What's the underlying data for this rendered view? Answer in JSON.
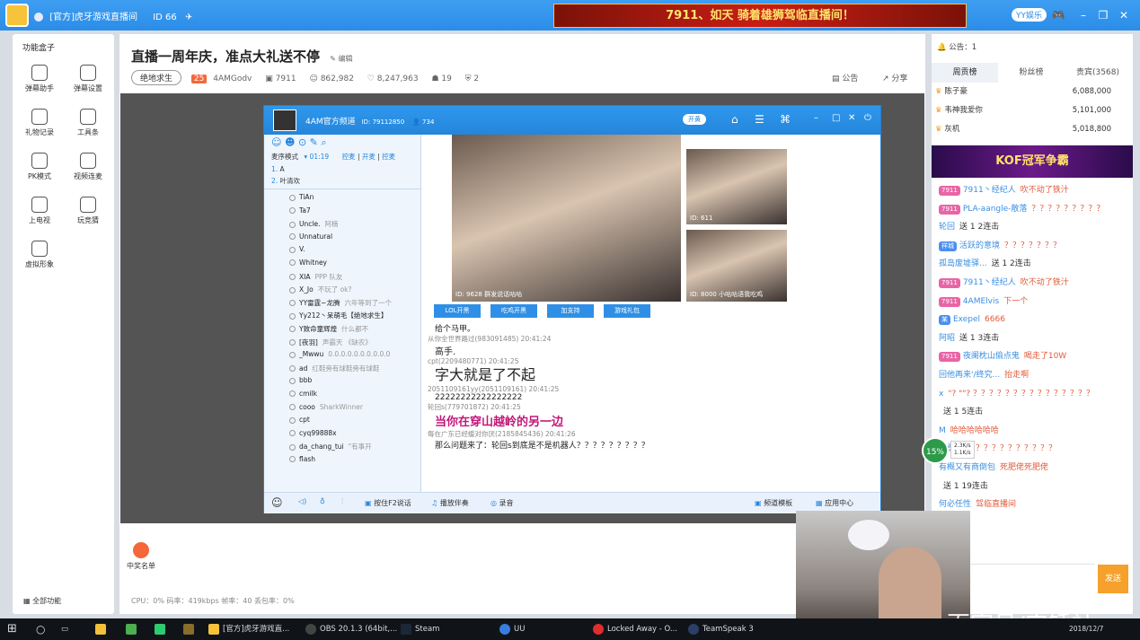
{
  "window": {
    "title": "[官方]虎牙游戏直播间",
    "id_label": "ID 66",
    "banner": "7911、如天  骑着雄狮驾临直播间！",
    "yy_badge": "YY娱乐"
  },
  "left_panel": {
    "heading": "功能盒子",
    "tools": [
      {
        "label": "弹幕助手",
        "icon": "danmaku-helper-icon"
      },
      {
        "label": "弹幕设置",
        "icon": "danmaku-settings-icon"
      },
      {
        "label": "礼物记录",
        "icon": "gift-record-icon"
      },
      {
        "label": "工具条",
        "icon": "toolbar-icon"
      },
      {
        "label": "PK模式",
        "icon": "pk-mode-icon"
      },
      {
        "label": "视频连麦",
        "icon": "video-link-icon"
      },
      {
        "label": "上电视",
        "icon": "tv-icon"
      },
      {
        "label": "玩竞猜",
        "icon": "guess-icon"
      },
      {
        "label": "虚拟形象",
        "icon": "avatar-icon"
      }
    ],
    "winners": "中奖名单",
    "all_functions": "全部功能"
  },
  "room": {
    "title": "直播一周年庆，准点大礼送不停",
    "edit_label": "编辑",
    "category": "绝地求生",
    "level": "25",
    "host": "4AMGodv",
    "room_id": "7911",
    "fans": "862,982",
    "subscribers": "8,247,963",
    "gifts": "19",
    "guards": "2",
    "notice_label": "公告",
    "share_label": "分享"
  },
  "status_bar": "CPU：0%   码率：419kbps   帧率：40   丢包率：0%",
  "yy_window": {
    "title": "4AM官方频道",
    "channel_id": "ID: 79112850",
    "online": "734",
    "toggle": "开黄",
    "mode": "麦序模式",
    "timer": "01:19",
    "actions": [
      "控麦",
      "开麦",
      "控麦"
    ],
    "queue": [
      {
        "pos": "1.",
        "name": "A"
      },
      {
        "pos": "2.",
        "name": "叶清欢"
      }
    ],
    "members": [
      "TiAn",
      "Ta7",
      "Uncle.",
      "Unnatural",
      "V.",
      "Whitney",
      "XIA",
      "X_Jo",
      "YY雷霆~龙腾",
      "Yy212丶呆萌毛【绝地求生】",
      "Y致命童辉煌",
      "[夜羽]",
      "_Mwwu",
      "ad",
      "bbb",
      "cmilk",
      "cooo",
      "cpt",
      "cyq99888x",
      "da_chang_tui",
      "flash"
    ],
    "member_notes": [
      "",
      "",
      "阿楠",
      "",
      "",
      "",
      "PPP 队友",
      "不玩了 ok?",
      "六年等到了一个",
      "",
      "什么都不",
      "声霸天  《缺农》",
      "0.0.0.0.0.0.0.0.0.0",
      "红鞋旁有球鞋旁有球鞋",
      "",
      "",
      "SharkWinner",
      "",
      "",
      "\"有事开",
      ""
    ],
    "video_labels": {
      "main": "ID: 9628   群发说话咕咕",
      "top_right": "ID: 611",
      "bottom_right": "ID: 8000   小咕咕语我吃鸡"
    },
    "video_buttons": [
      "LOL开黑",
      "吃鸡开黑",
      "加支持",
      "游戏礼包"
    ],
    "chat": [
      {
        "meta": "",
        "msg": "给个马甲。"
      },
      {
        "meta": "从你全世界路过(983091485) 20:41:24",
        "msg": "高手."
      },
      {
        "meta": "cpt(2209480771) 20:41:25",
        "msg": "字大就是了不起"
      },
      {
        "meta": "2051109161yy(2051109161) 20:41:25",
        "msg": "22222222222222222"
      },
      {
        "meta": "轮回s(779701872) 20:41:25",
        "msg": "当你在穿山越岭的另一边"
      },
      {
        "meta": "每在广东已经缓对你厌(2185845436) 20:41:26",
        "msg": "那么问题来了：轮回s到底是不是机器人？？？？？？？？？"
      }
    ],
    "bottom": {
      "ptt": "按住F2说话",
      "music": "播放伴奏",
      "record": "录音",
      "template": "频道模板",
      "apps": "应用中心"
    }
  },
  "right_panel": {
    "notice": "公告：1",
    "tabs": [
      "周贡榜",
      "粉丝榜",
      "贵宾(3568)"
    ],
    "ranking": [
      {
        "name": "陈子豪",
        "score": "6,088,000"
      },
      {
        "name": "韦神我爱你",
        "score": "5,101,000"
      },
      {
        "name": "灰机",
        "score": "5,018,800"
      }
    ],
    "kof_banner": "KOF冠军争霸",
    "chat": [
      {
        "tag": "7911",
        "user": "7911丶经纪人",
        "text": "吹不动了铁汁"
      },
      {
        "tag": "7911",
        "user": "PLA-aangle-散落",
        "text": "？？？？？？？？？"
      },
      {
        "tag": "",
        "user": "轮回",
        "text": "送  1 2连击"
      },
      {
        "tag": "祥城",
        "user": "活跃的意境",
        "text": "？？？？？？？"
      },
      {
        "tag": "",
        "user": "孤岛废墟驿...",
        "text": "送  1 2连击"
      },
      {
        "tag": "7911",
        "user": "7911丶经纪人",
        "text": "吹不动了铁汁"
      },
      {
        "tag": "7911",
        "user": "4AMElvis",
        "text": "下一个"
      },
      {
        "tag": "某",
        "user": "Exepel",
        "text": "6666"
      },
      {
        "tag": "",
        "user": "阿昭",
        "text": "送  1 3连击"
      },
      {
        "tag": "7911",
        "user": "夜阑枕山偷点鬼",
        "text": "喝走了10W"
      },
      {
        "tag": "",
        "user": "回他再来'/终究...",
        "text": "抬走啊"
      },
      {
        "tag": "",
        "user": "x",
        "text": "\"?  \"\"? ？？？？？？？？？？？？？？？"
      },
      {
        "tag": "",
        "user": "",
        "text": "送  1 5连击"
      },
      {
        "tag": "",
        "user": "M",
        "text": "哈哈哈哈哈哈"
      },
      {
        "tag": "",
        "user": "思勇",
        "text": "？？？？？？？？？？？？"
      },
      {
        "tag": "",
        "user": "有概又有商倒包",
        "text": "死肥佬死肥佬"
      },
      {
        "tag": "",
        "user": "",
        "text": "送  1 19连击"
      },
      {
        "tag": "",
        "user": "何必任性",
        "text": "驾临直播间"
      }
    ],
    "send_label": "发送",
    "net_percent": "15%",
    "up_speed": "2.3K/s",
    "down_speed": "1.1K/s"
  },
  "watermark": "百家号/实锤社",
  "taskbar": {
    "items": [
      "[官方]虎牙游戏直...",
      "OBS 20.1.3 (64bit,...",
      "Steam",
      "UU",
      "Locked Away - O...",
      "TeamSpeak 3"
    ],
    "date": "2018/12/7"
  },
  "colors": {
    "accent": "#2b8de8",
    "send": "#f5a12b",
    "banner": "#c81d16"
  }
}
